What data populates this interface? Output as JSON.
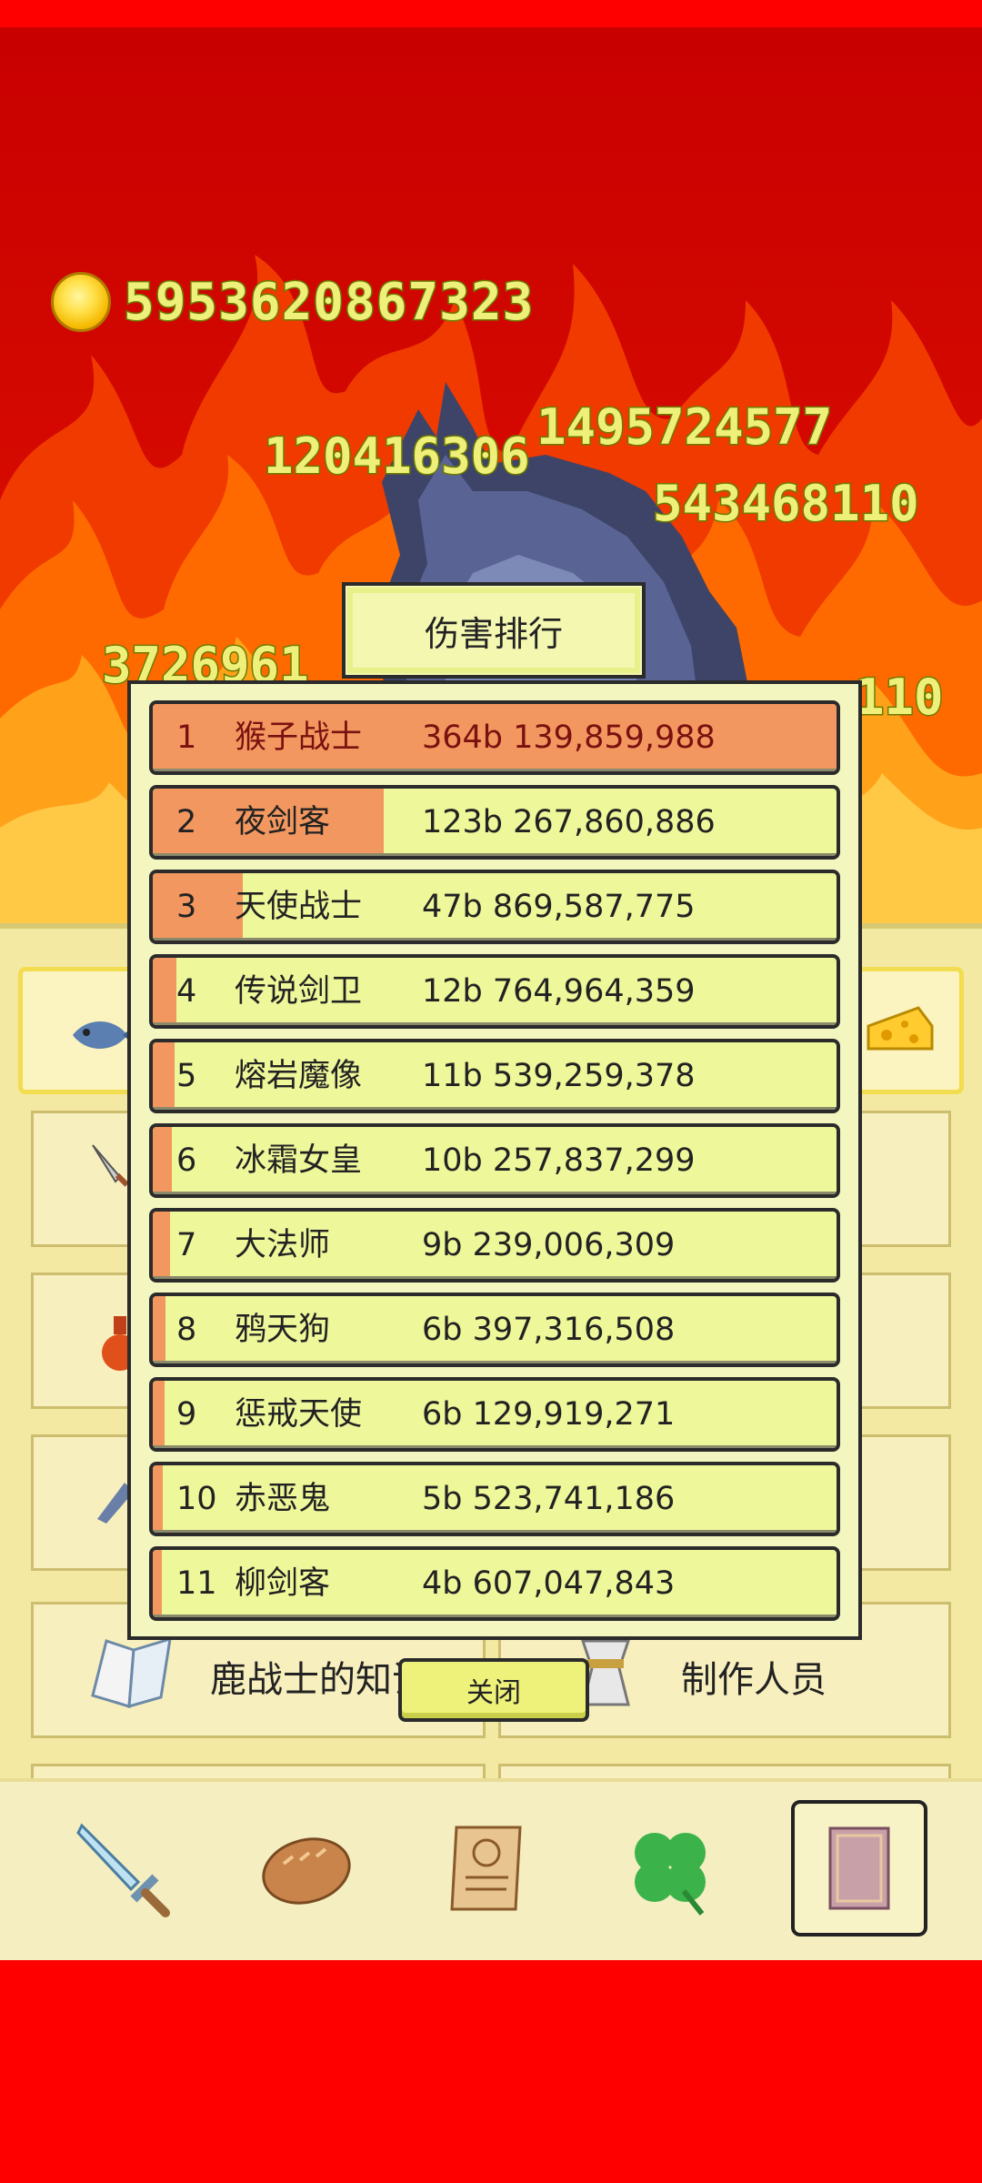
{
  "hud": {
    "coin_icon": "gold-coin-icon",
    "coins": "5953620867323"
  },
  "floating_damage": [
    "120416306",
    "1495724577",
    "543468110",
    "3726961",
    "110"
  ],
  "dialog": {
    "title": "伤害排行",
    "close_label": "关闭",
    "rows": [
      {
        "rank": "1",
        "name": "猴子战士",
        "damage": "364b 139,859,988",
        "share": 1.0
      },
      {
        "rank": "2",
        "name": "夜剑客",
        "damage": "123b 267,860,886",
        "share": 0.338
      },
      {
        "rank": "3",
        "name": "天使战士",
        "damage": "47b 869,587,775",
        "share": 0.131
      },
      {
        "rank": "4",
        "name": "传说剑卫",
        "damage": "12b 764,964,359",
        "share": 0.035
      },
      {
        "rank": "5",
        "name": "熔岩魔像",
        "damage": "11b 539,259,378",
        "share": 0.032
      },
      {
        "rank": "6",
        "name": "冰霜女皇",
        "damage": "10b 257,837,299",
        "share": 0.028
      },
      {
        "rank": "7",
        "name": "大法师",
        "damage": "9b 239,006,309",
        "share": 0.025
      },
      {
        "rank": "8",
        "name": "鸦天狗",
        "damage": "6b 397,316,508",
        "share": 0.018
      },
      {
        "rank": "9",
        "name": "惩戒天使",
        "damage": "6b 129,919,271",
        "share": 0.017
      },
      {
        "rank": "10",
        "name": "赤恶鬼",
        "damage": "5b 523,741,186",
        "share": 0.015
      },
      {
        "rank": "11",
        "name": "柳剑客",
        "damage": "4b 607,047,843",
        "share": 0.013
      }
    ]
  },
  "menu": {
    "tile_knowledge": "鹿战士的知识",
    "tile_credits": "制作人员"
  },
  "bottom_nav": [
    {
      "icon": "sword-icon"
    },
    {
      "icon": "bread-icon"
    },
    {
      "icon": "scroll-icon"
    },
    {
      "icon": "clover-icon"
    },
    {
      "icon": "book-icon",
      "active": true
    }
  ],
  "colors": {
    "outer_bg": "#ff0000",
    "row_bg": "#eef79a",
    "damage_bar": "#f2975f",
    "number_text": "#eef07a"
  }
}
